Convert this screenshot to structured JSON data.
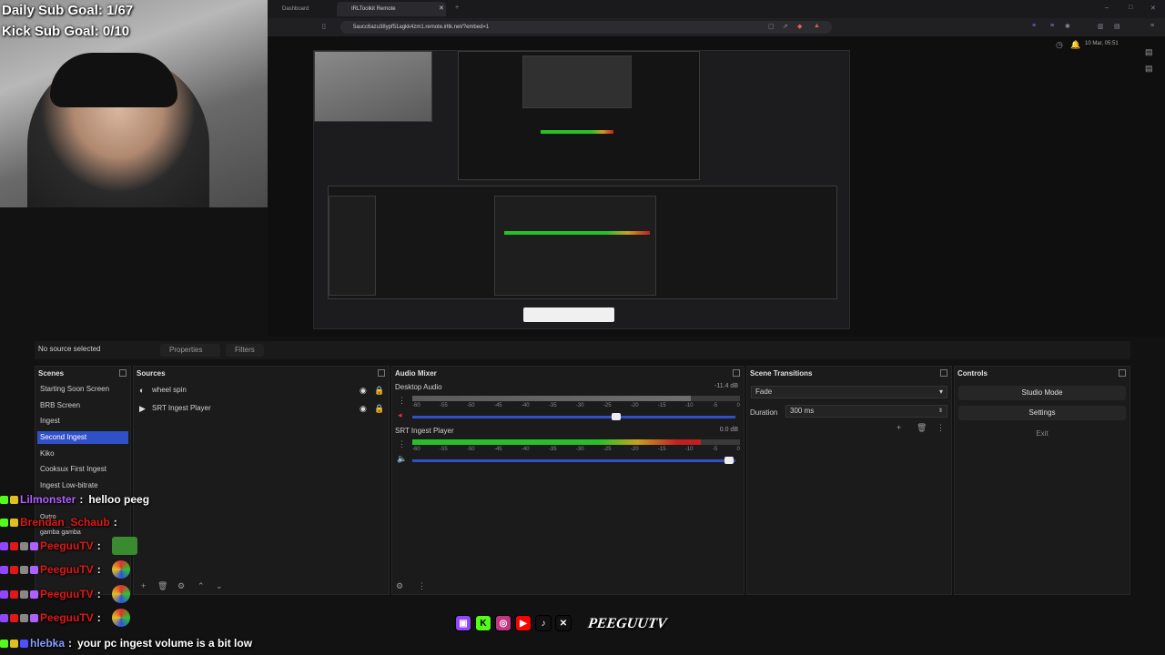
{
  "overlay": {
    "daily_goal": "Daily Sub Goal: 1/67",
    "kick_goal": "Kick Sub Goal: 0/10"
  },
  "browser": {
    "tabs": [
      {
        "label": "Dashboard"
      },
      {
        "label": "IRLToolkit Remote"
      }
    ],
    "url": "5aucc6azu38ypf51agkk4zm1.remote.irltk.net/?embed=1",
    "clock": "10 Mar, 05:51"
  },
  "obs": {
    "no_source": "No source selected",
    "properties_label": "Properties",
    "filters_label": "Filters",
    "scenes_title": "Scenes",
    "scenes": [
      "Starting Soon Screen",
      "BRB Screen",
      "Ingest",
      "Second Ingest",
      "Kiko",
      "Cooksux First Ingest",
      "Ingest Low-bitrate",
      "Outro",
      "gamba gamba"
    ],
    "selected_scene": "Second Ingest",
    "sources_title": "Sources",
    "sources": [
      "wheel spin",
      "SRT Ingest Player"
    ],
    "audio_title": "Audio Mixer",
    "audio": [
      {
        "name": "Desktop Audio",
        "db": "-11.4 dB",
        "level": 0.85,
        "volume": 0.63
      },
      {
        "name": "SRT Ingest Player",
        "db": "0.0 dB",
        "level": 0.88,
        "volume": 0.98
      }
    ],
    "ticks": [
      "-60",
      "-55",
      "-50",
      "-45",
      "-40",
      "-35",
      "-30",
      "-25",
      "-20",
      "-15",
      "-10",
      "-5",
      "0"
    ],
    "transitions_title": "Scene Transitions",
    "transition": "Fade",
    "duration_label": "Duration",
    "duration": "300 ms",
    "controls_title": "Controls",
    "studio_mode": "Studio Mode",
    "settings": "Settings",
    "exit": "Exit"
  },
  "chat": [
    {
      "user": "Lilmonster",
      "sep": " :",
      "msg": "helloo peeg",
      "color": "#b060ff"
    },
    {
      "user": "Brendan_Schaub",
      "sep": " :",
      "msg": "",
      "color": "#e01818"
    },
    {
      "user": "PeeguuTV",
      "sep": " :",
      "msg": "",
      "color": "#e01818"
    },
    {
      "user": "PeeguuTV",
      "sep": " :",
      "msg": "",
      "color": "#e01818"
    },
    {
      "user": "PeeguuTV",
      "sep": " :",
      "msg": "",
      "color": "#e01818"
    },
    {
      "user": "PeeguuTV",
      "sep": " :",
      "msg": "",
      "color": "#e01818"
    },
    {
      "user": "hlebka",
      "sep": " :",
      "msg": "your pc ingest volume is a bit low",
      "color": "#8a9cff"
    }
  ],
  "brand": {
    "name": "PEEGUUTV",
    "icons": [
      "twitch-icon",
      "kick-icon",
      "instagram-icon",
      "youtube-icon",
      "tiktok-icon",
      "x-icon"
    ]
  },
  "colors": {
    "accent": "#3050c8",
    "meter_green": "#28c028",
    "meter_yellow": "#c8a020",
    "meter_red": "#c02020"
  }
}
